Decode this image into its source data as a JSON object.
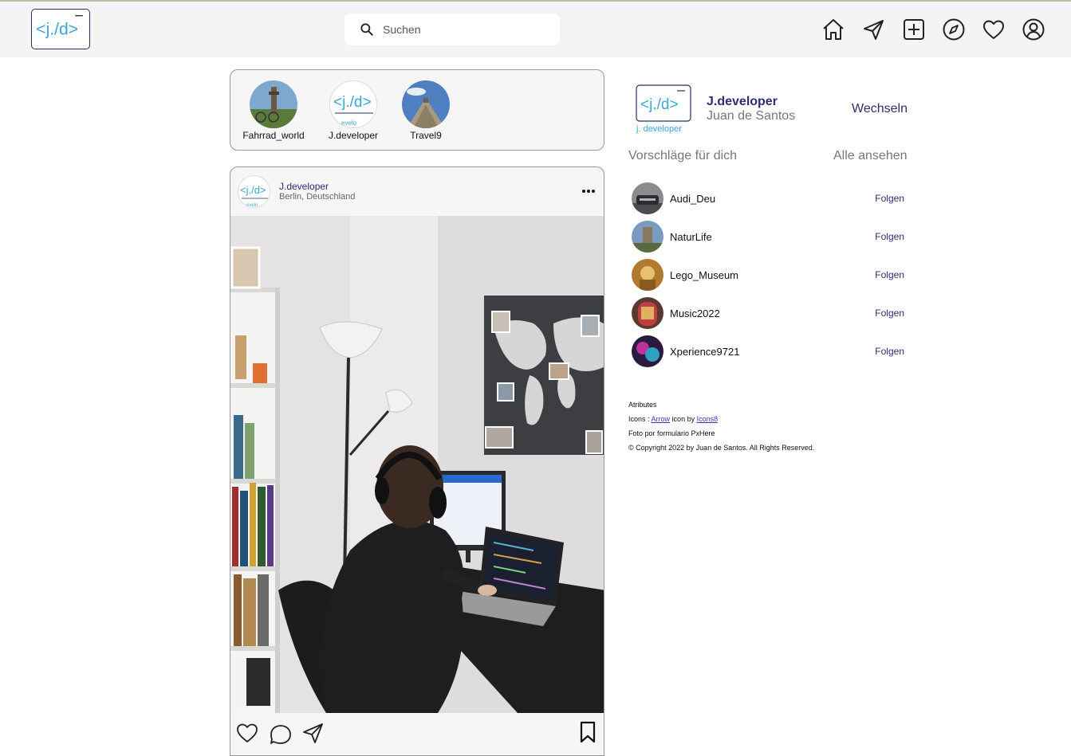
{
  "header": {
    "search_placeholder": "Suchen"
  },
  "stories": [
    {
      "name": "Fahrrad_world"
    },
    {
      "name": "J.developer"
    },
    {
      "name": "Travel9"
    }
  ],
  "post": {
    "username": "J.developer",
    "location": "Berlin, Deutschland"
  },
  "profile": {
    "username": "J.developer",
    "full_name": "Juan de Santos",
    "switch_label": "Wechseln"
  },
  "suggestions": {
    "title": "Vorschläge für dich",
    "see_all": "Alle ansehen",
    "follow_label": "Folgen",
    "items": [
      {
        "name": "Audi_Deu"
      },
      {
        "name": "NaturLife"
      },
      {
        "name": "Lego_Museum"
      },
      {
        "name": "Music2022"
      },
      {
        "name": "Xperience9721"
      }
    ]
  },
  "credits": {
    "heading": "Atributes",
    "icons_prefix": "Icons :",
    "icons_link1": "Arrow",
    "icons_mid": "icon by",
    "icons_link2": "Icons8",
    "photo": "Foto por formulario PxHere",
    "copyright": "© Copyright 2022 by Juan de Santos. All Rights Reserved."
  },
  "logo": {
    "text": "<j./d>",
    "subtext": "developer"
  },
  "colors": {
    "brand": "#2a2f6e",
    "logo_accent": "#3aa7d8",
    "header_bg": "#f4f4f4"
  },
  "icons": [
    "search-icon",
    "home-icon",
    "send-icon",
    "add-icon",
    "explore-icon",
    "heart-icon",
    "profile-icon",
    "more-icon",
    "like-icon",
    "comment-icon",
    "share-icon",
    "bookmark-icon"
  ]
}
